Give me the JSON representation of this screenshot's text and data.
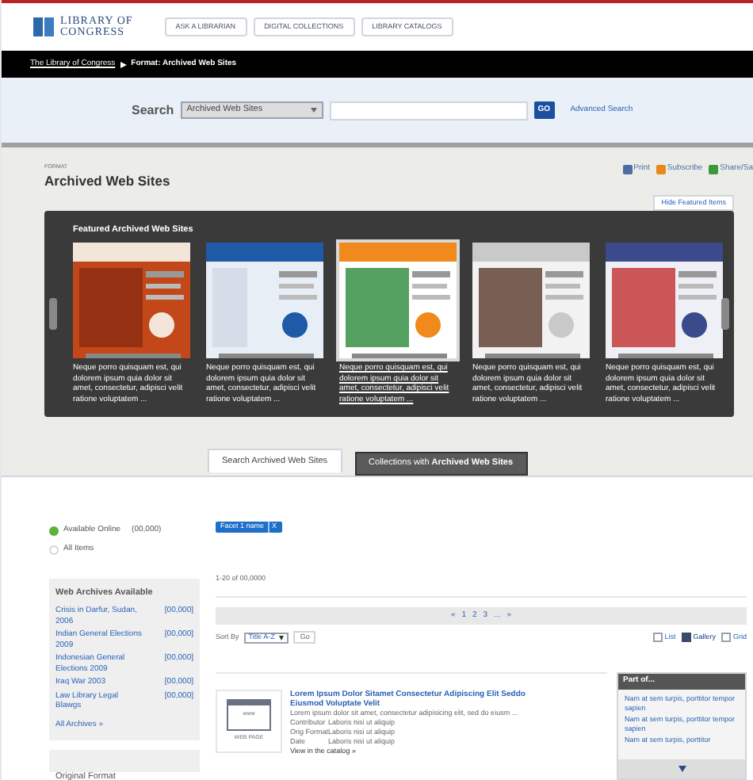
{
  "header": {
    "logo_lines": [
      "LIBRARY OF",
      "CONGRESS"
    ],
    "buttons": [
      "ASK A LIBRARIAN",
      "DIGITAL COLLECTIONS",
      "LIBRARY CATALOGS"
    ]
  },
  "breadcrumb": {
    "link": "The Library of Congress",
    "current": "Format: Archived Web Sites"
  },
  "search": {
    "label": "Search",
    "scope": "Archived Web Sites",
    "go": "GO",
    "advanced": "Advanced Search"
  },
  "page": {
    "eyebrow": "FORMAT",
    "title": "Archived Web Sites",
    "actions": [
      "Print",
      "Subscribe",
      "Share/Sa"
    ],
    "hide_button": "Hide Featured Items"
  },
  "featured": {
    "heading": "Featured Archived Web Sites",
    "items": [
      {
        "caption": "Neque porro quisquam est, qui dolorem ipsum quia dolor sit amet, consectetur, adipisci velit ratione voluptatem ...",
        "selected": false
      },
      {
        "caption": "Neque porro quisquam est, qui dolorem ipsum quia dolor sit amet, consectetur, adipisci velit ratione voluptatem ...",
        "selected": false
      },
      {
        "caption": "Neque porro quisquam est, qui dolorem ipsum quia dolor sit amet, consectetur, adipisci velit ratione voluptatem ...",
        "selected": true
      },
      {
        "caption": "Neque porro quisquam est, qui dolorem ipsum quia dolor sit amet, consectetur, adipisci velit ratione voluptatem ...",
        "selected": false
      },
      {
        "caption": "Neque porro quisquam est, qui dolorem ipsum quia dolor sit amet, consectetur, adipisci velit ratione voluptatem ...",
        "selected": false
      }
    ]
  },
  "tabs": [
    {
      "label": "Search Archived Web Sites",
      "selected": true
    },
    {
      "label": "Collections with **Archived Web Sites**",
      "selected": false
    }
  ],
  "availability": [
    {
      "label": "Available Online",
      "count": "(00,000)",
      "selected": true
    },
    {
      "label": "All Items",
      "selected": false
    }
  ],
  "archives": {
    "heading": "Web Archives Available",
    "items": [
      {
        "label": "Crisis in Darfur, Sudan, 2006",
        "count": "[00,000]"
      },
      {
        "label": "Indian General Elections 2009",
        "count": "[00,000]"
      },
      {
        "label": "Indonesian General Elections 2009",
        "count": "[00,000]"
      },
      {
        "label": "Iraq War 2003",
        "count": "[00,000]"
      },
      {
        "label": "Law Library Legal Blawgs",
        "count": "[00,000]"
      }
    ],
    "more": "All Archives »"
  },
  "original_format": {
    "heading": "Original Format"
  },
  "facet": {
    "label": "Facet 1 name",
    "remove": "X"
  },
  "results_count": "1-20 of 00,0000",
  "pager": [
    "«",
    "1",
    "2",
    "3",
    "...",
    "»"
  ],
  "sort": {
    "label": "Sort By",
    "value": "Title A-Z",
    "go": "Go"
  },
  "views": [
    {
      "label": "List",
      "selected": false
    },
    {
      "label": "Gallery",
      "selected": true
    },
    {
      "label": "Grid",
      "selected": false
    }
  ],
  "result": {
    "thumb_text": "www",
    "thumb_label": "WEB PAGE",
    "title": "Lorem Ipsum Dolor Sitamet Consectetur Adipiscing Elit Seddo Eiusmod Voluptate Velit",
    "description": "Lorem ipsum dolor sit amet, consectetur adipisicing elit, sed do eiusm ...",
    "fields": [
      {
        "name": "Contributor",
        "value": "Laboris nisi ut aliquip"
      },
      {
        "name": "Orig Format",
        "value": "Laboris nisi ut aliquip"
      },
      {
        "name": "Date",
        "value": "Laboris nisi ut aliquip"
      }
    ],
    "link": "View in the catalog »"
  },
  "part_of": {
    "heading": "Part of...",
    "items": [
      "Nam at sem turpis, porttitor tempor sapien",
      "Nam at sem turpis, porttitor tempor sapien",
      "Nam at sem turpis, porttitor"
    ]
  }
}
